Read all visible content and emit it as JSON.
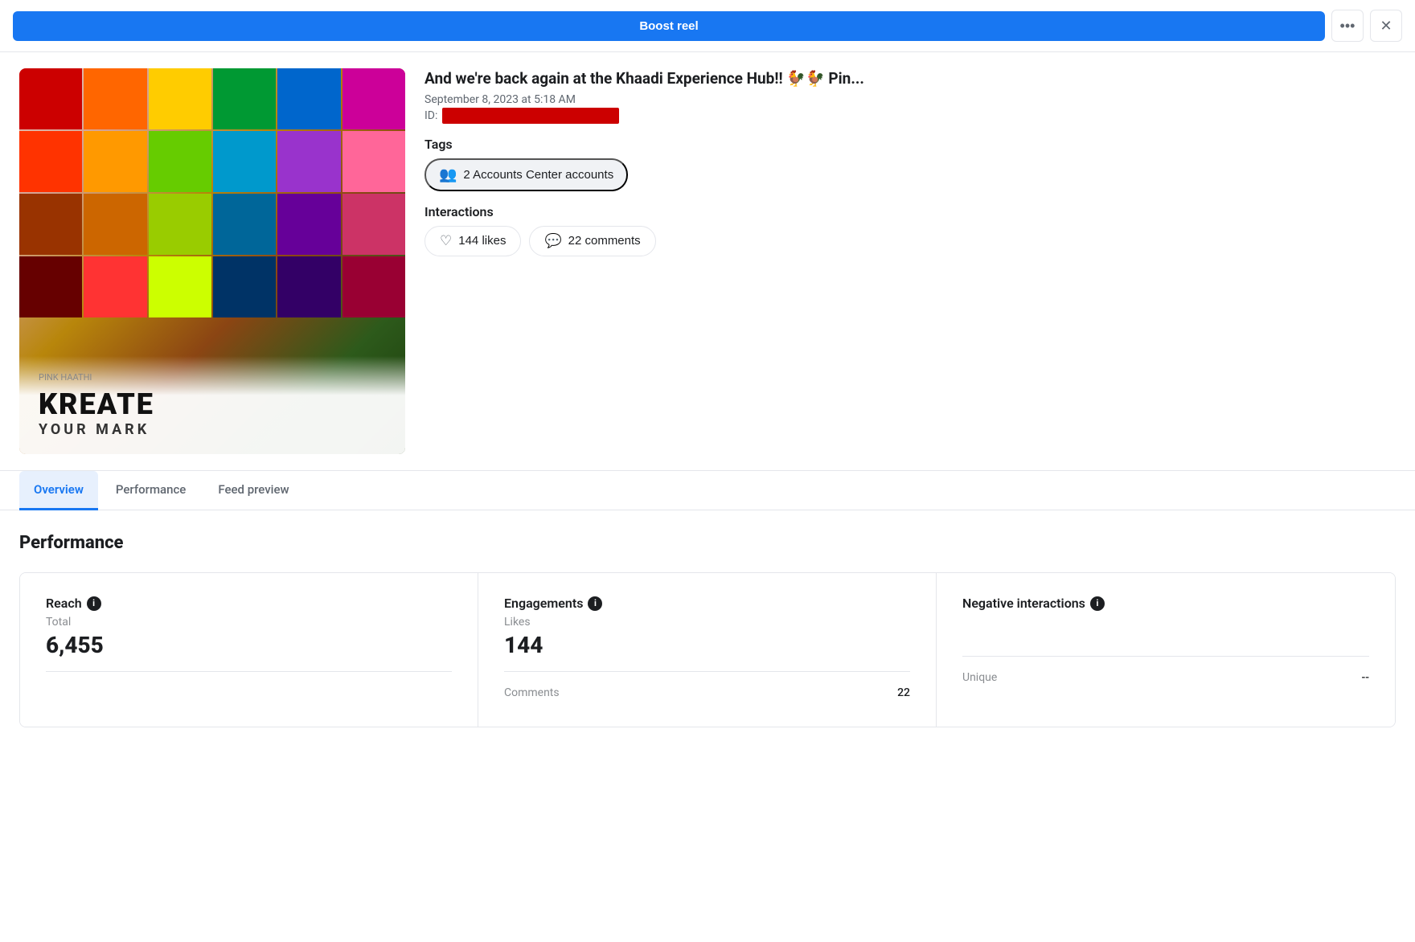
{
  "boost_bar": {
    "boost_btn_label": "Boost reel",
    "more_icon": "•••",
    "close_icon": "✕"
  },
  "post": {
    "title": "And we're back again at the Khaadi Experience Hub!! 🐓🐓 Pin...",
    "date": "September 8, 2023 at 5:18 AM",
    "id_label": "ID:",
    "id_redacted": true
  },
  "tags": {
    "section_label": "Tags",
    "accounts_tag": "2 Accounts Center accounts"
  },
  "interactions": {
    "section_label": "Interactions",
    "likes": "144 likes",
    "comments": "22 comments"
  },
  "tabs": [
    {
      "id": "overview",
      "label": "Overview",
      "active": true
    },
    {
      "id": "performance",
      "label": "Performance",
      "active": false
    },
    {
      "id": "feed-preview",
      "label": "Feed preview",
      "active": false
    }
  ],
  "performance": {
    "section_title": "Performance",
    "metrics": [
      {
        "id": "reach",
        "header": "Reach",
        "has_info": true,
        "sub_label": "Total",
        "main_value": "6,455",
        "rows": []
      },
      {
        "id": "engagements",
        "header": "Engagements",
        "has_info": true,
        "sub_label": "Likes",
        "main_value": "144",
        "rows": [
          {
            "label": "Comments",
            "value": "22"
          }
        ]
      },
      {
        "id": "negative-interactions",
        "header": "Negative interactions",
        "has_info": true,
        "sub_label": "",
        "main_value": "",
        "rows": [
          {
            "label": "Unique",
            "value": "--"
          }
        ]
      }
    ]
  },
  "thumbnail": {
    "badge_icon": "▶",
    "kreate_label": "KREATE",
    "kreate_sub": "YOUR MARK",
    "pink_haathi": "PINK HAATHI"
  },
  "fabric_colors": [
    "#cc0000",
    "#ff6600",
    "#ffcc00",
    "#009933",
    "#0066cc",
    "#cc0099",
    "#ff3300",
    "#ff9900",
    "#66cc00",
    "#0099cc",
    "#9933cc",
    "#ff6699",
    "#993300",
    "#cc6600",
    "#99cc00",
    "#006699",
    "#660099",
    "#cc3366",
    "#660000",
    "#ff3333",
    "#ccff00",
    "#003366",
    "#330066",
    "#990033",
    "#ff0000",
    "#ff9933",
    "#cccc00",
    "#00cc66",
    "#0000ff",
    "#cc00cc"
  ]
}
